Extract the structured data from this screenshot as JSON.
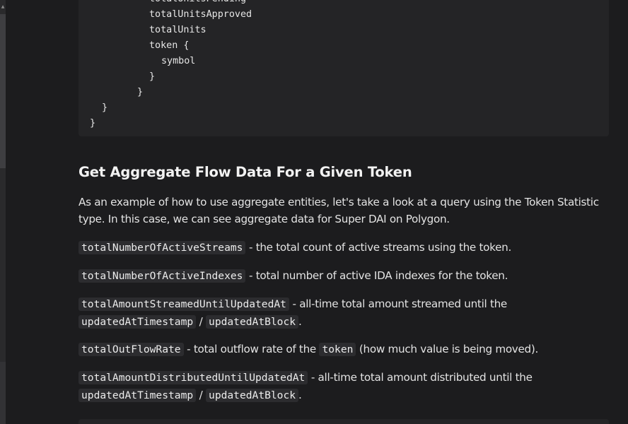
{
  "code": {
    "lines": [
      {
        "text": "totalUnitsPending"
      },
      {
        "text": "totalUnitsApproved"
      },
      {
        "text": "totalUnits"
      },
      {
        "text": "token {"
      },
      {
        "text": "symbol"
      },
      {
        "text": "}"
      },
      {
        "text": "}"
      },
      {
        "text": "}"
      },
      {
        "text": "}"
      }
    ]
  },
  "section": {
    "heading": "Get Aggregate Flow Data For a Given Token",
    "intro": "As an example of how to use aggregate entities, let's take a look at a query using the Token Statistic type. In this case, we can see aggregate data for Super DAI on Polygon."
  },
  "fields": [
    {
      "code": "totalNumberOfActiveStreams",
      "desc": " - the total count of active streams using the token."
    },
    {
      "code": "totalNumberOfActiveIndexes",
      "desc": " - total number of active IDA indexes for the token."
    },
    {
      "code": "totalAmountStreamedUntilUpdatedAt",
      "desc": " - all-time total amount streamed until the",
      "code2": "updatedAtTimestamp",
      "sep": " / ",
      "code3": "updatedAtBlock",
      "end": "."
    },
    {
      "code": "totalOutFlowRate",
      "desc": " - total outflow rate of the ",
      "code2": "token",
      "desc2": " (how much value is being moved)."
    },
    {
      "code": "totalAmountDistributedUntilUpdatedAt",
      "desc": " - all-time total amount distributed until the",
      "code2": "updatedAtTimestamp",
      "sep": " / ",
      "code3": "updatedAtBlock",
      "end": "."
    }
  ]
}
